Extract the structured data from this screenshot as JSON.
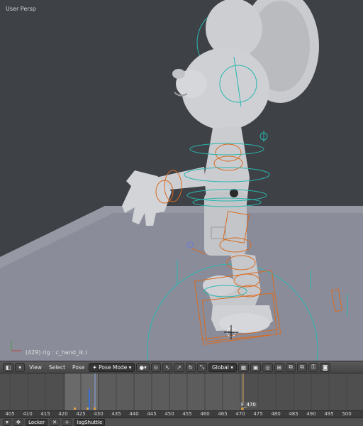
{
  "viewport": {
    "view_label": "User Persp",
    "status_text": "(429) rig : c_hand_ik.l"
  },
  "header": {
    "menus": [
      "View",
      "Select",
      "Pose"
    ],
    "mode_label": "Pose Mode",
    "orientation_label": "Global"
  },
  "timeline": {
    "ruler_ticks": [
      "405",
      "410",
      "415",
      "420",
      "425",
      "430",
      "435",
      "440",
      "445",
      "450",
      "455",
      "460",
      "465",
      "470",
      "475",
      "480",
      "485",
      "490",
      "495",
      "500"
    ],
    "current_frame_label": "F_470"
  },
  "bottombar": {
    "field_1": "Locker",
    "field_2": "logShuttle"
  },
  "colors": {
    "viewport_bg": "#3c3f43",
    "floor": "#8a8c99",
    "bone_orange": "#d96b20",
    "bone_cyan": "#2ab7b0",
    "timeline_bg": "#4f4f4f"
  }
}
